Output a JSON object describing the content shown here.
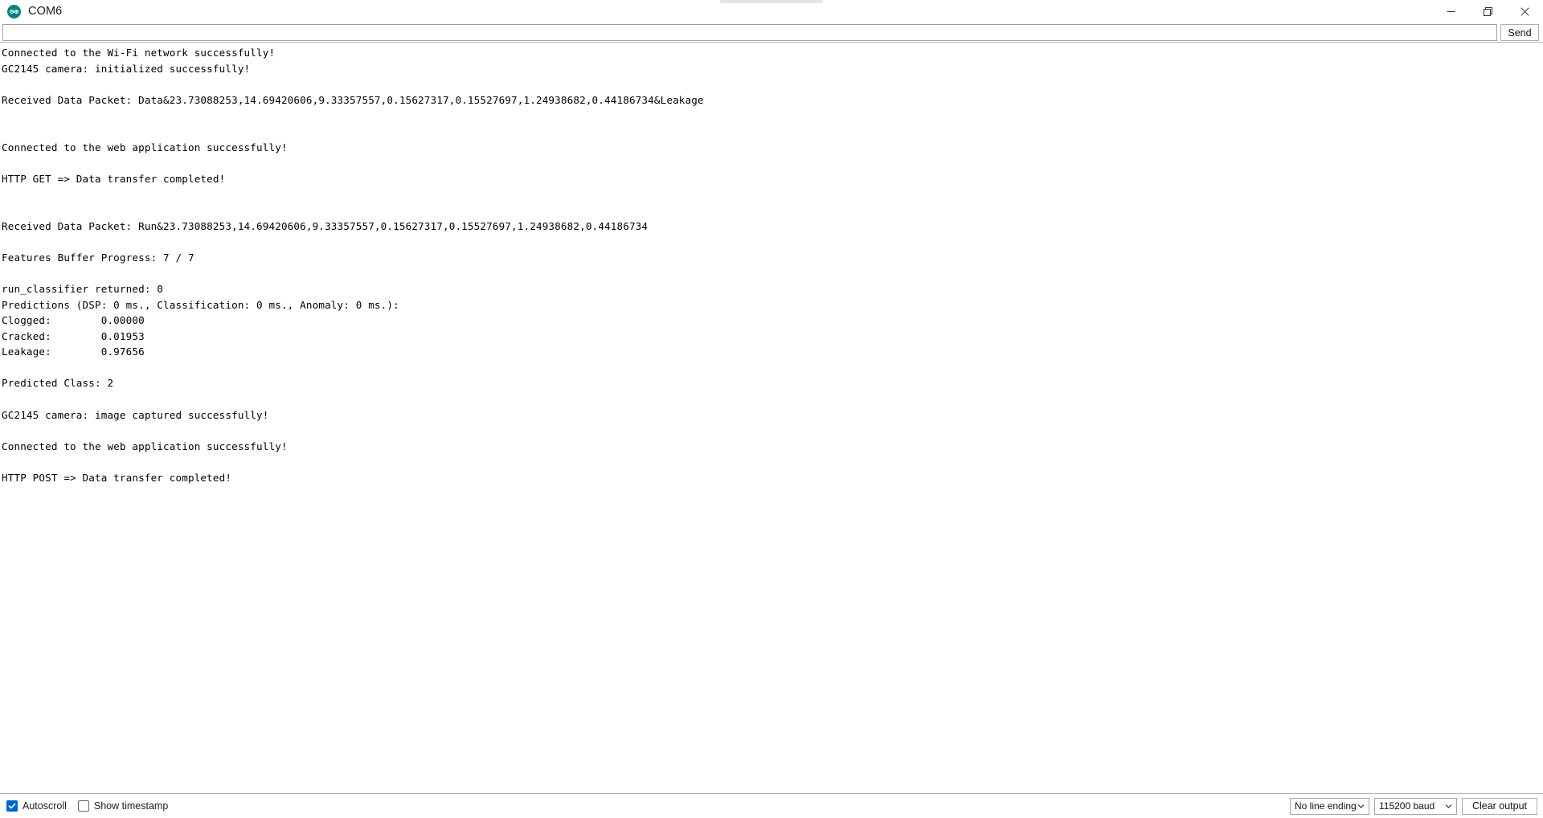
{
  "window": {
    "title": "COM6",
    "icon": "arduino-logo-icon",
    "controls": {
      "minimize": "minimize-icon",
      "restore": "restore-icon",
      "close": "close-icon"
    }
  },
  "send_bar": {
    "input_value": "",
    "input_placeholder": "",
    "send_label": "Send"
  },
  "console": {
    "lines": [
      "Connected to the Wi-Fi network successfully!",
      "GC2145 camera: initialized successfully!",
      "",
      "Received Data Packet: Data&23.73088253,14.69420606,9.33357557,0.15627317,0.15527697,1.24938682,0.44186734&Leakage",
      "",
      "",
      "Connected to the web application successfully!",
      "",
      "HTTP GET => Data transfer completed!",
      "",
      "",
      "Received Data Packet: Run&23.73088253,14.69420606,9.33357557,0.15627317,0.15527697,1.24938682,0.44186734",
      "",
      "Features Buffer Progress: 7 / 7",
      "",
      "run_classifier returned: 0",
      "Predictions (DSP: 0 ms., Classification: 0 ms., Anomaly: 0 ms.):",
      "Clogged:        0.00000",
      "Cracked:        0.01953",
      "Leakage:        0.97656",
      "",
      "Predicted Class: 2",
      "",
      "GC2145 camera: image captured successfully!",
      "",
      "Connected to the web application successfully!",
      "",
      "HTTP POST => Data transfer completed!"
    ]
  },
  "status_bar": {
    "autoscroll_label": "Autoscroll",
    "autoscroll_checked": true,
    "timestamp_label": "Show timestamp",
    "timestamp_checked": false,
    "line_ending_value": "No line ending",
    "baud_value": "115200 baud",
    "clear_label": "Clear output"
  },
  "colors": {
    "accent": "#0064c8",
    "arduino_teal": "#008184",
    "text": "#000000",
    "border": "#b3b3b3"
  }
}
